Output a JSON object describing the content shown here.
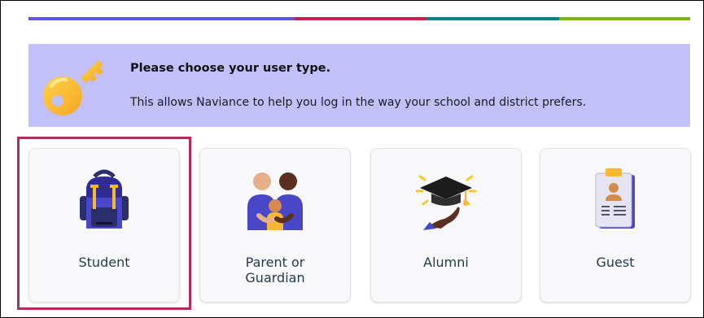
{
  "progress": {
    "colors": [
      "#5d56e0",
      "#c5214f",
      "#127b86",
      "#7ab520"
    ]
  },
  "banner": {
    "title": "Please choose your user type.",
    "description": "This allows Naviance to help you log in the way your school and district prefers.",
    "icon": "key-icon",
    "background": "#c2c0fb"
  },
  "user_types": [
    {
      "label": "Student",
      "icon": "backpack-icon",
      "selected": true
    },
    {
      "label": "Parent or\nGuardian",
      "icon": "parent-child-icon",
      "selected": false
    },
    {
      "label": "Alumni",
      "icon": "graduation-cap-icon",
      "selected": false
    },
    {
      "label": "Guest",
      "icon": "clipboard-badge-icon",
      "selected": false
    }
  ],
  "selection_color": "#b52d5c"
}
